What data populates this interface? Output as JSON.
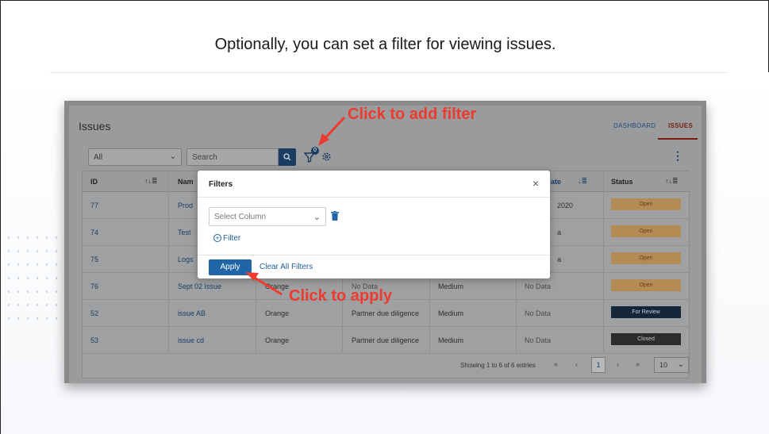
{
  "slide": {
    "title": "Optionally, you can set a filter for viewing issues."
  },
  "app": {
    "title": "Issues",
    "tabs": [
      {
        "label": "DASHBOARD",
        "active": false
      },
      {
        "label": "ISSUES",
        "active": true
      }
    ],
    "toolbar": {
      "select_value": "All",
      "search_placeholder": "Search",
      "filter_count": "0"
    }
  },
  "table": {
    "headers": {
      "id": "ID",
      "name": "Nam",
      "date": "ate",
      "status": "Status"
    },
    "rows": [
      {
        "id": "77",
        "name": "Prod",
        "col3": "",
        "col4": "",
        "col5": "",
        "date": "2020",
        "status": "Open"
      },
      {
        "id": "74",
        "name": "Test",
        "col3": "",
        "col4": "",
        "col5": "",
        "date": "a",
        "status": "Open"
      },
      {
        "id": "75",
        "name": "Logs",
        "col3": "",
        "col4": "",
        "col5": "",
        "date": "a",
        "status": "Open"
      },
      {
        "id": "76",
        "name": "Sept 02 Issue",
        "col3": "Orange",
        "col4": "No Data",
        "col5": "Medium",
        "date": "No Data",
        "status": "Open"
      },
      {
        "id": "52",
        "name": "issue AB",
        "col3": "Orange",
        "col4": "Partner due diligence",
        "col5": "Medium",
        "date": "No Data",
        "status": "For Review"
      },
      {
        "id": "53",
        "name": "issue cd",
        "col3": "Orange",
        "col4": "Partner due diligence",
        "col5": "Medium",
        "date": "No Data",
        "status": "Closed"
      }
    ],
    "pagination": {
      "info": "Showing 1 to 6 of 6 entries",
      "first": "«",
      "prev": "‹",
      "current": "1",
      "next": "›",
      "last": "»",
      "page_size": "10"
    }
  },
  "modal": {
    "title": "Filters",
    "close": "×",
    "column_placeholder": "Select Column",
    "add_filter_label": "Filter",
    "apply_label": "Apply",
    "clear_label": "Clear All Filters"
  },
  "annotations": {
    "add_filter": "Click to add filter",
    "apply": "Click to apply",
    "color": "#ee3b30"
  }
}
